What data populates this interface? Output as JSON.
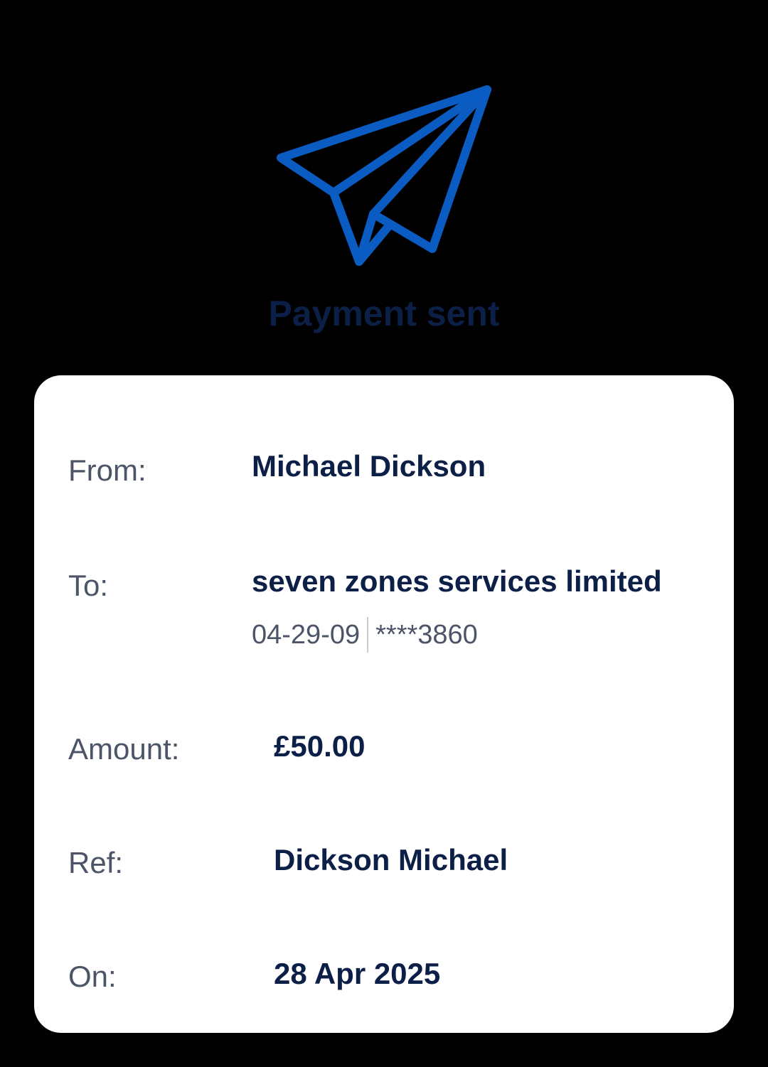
{
  "header": {
    "title": "Payment sent",
    "icon": "paper-plane-icon",
    "accent_color": "#0a5cc2"
  },
  "details": {
    "from_label": "From:",
    "from_value": "Michael Dickson",
    "to_label": "To:",
    "to_value": "seven zones services limited",
    "sort_code": "04-29-09",
    "account_masked": "****3860",
    "amount_label": "Amount:",
    "amount_value": "£50.00",
    "ref_label": "Ref:",
    "ref_value": "Dickson Michael",
    "on_label": "On:",
    "on_value": "28 Apr 2025"
  }
}
